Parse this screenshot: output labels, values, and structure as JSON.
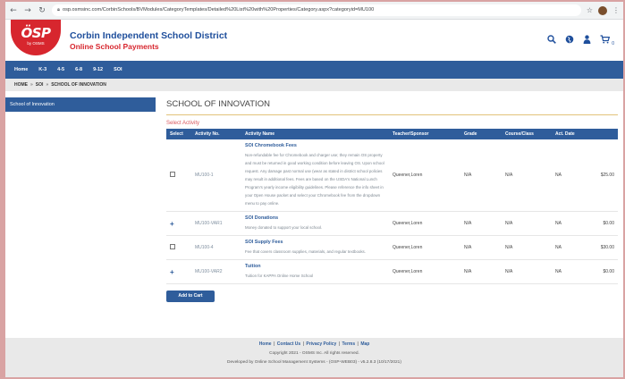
{
  "browser": {
    "url": "osp.osmsinc.com/CorbinSchools/BVModules/CategoryTemplates/Detailed%20List%20with%20Properties/Category.aspx?categoryid=MU100"
  },
  "header": {
    "logo_text": "ÖSP",
    "logo_sub": "by OSMS",
    "district_name": "Corbin Independent School District",
    "tagline": "Online School Payments",
    "cart_count": "0"
  },
  "nav": {
    "items": [
      "Home",
      "K-3",
      "4-5",
      "6-8",
      "9-12",
      "SOI"
    ]
  },
  "breadcrumb": {
    "items": [
      "HOME",
      "SOI",
      "SCHOOL OF INNOVATION"
    ]
  },
  "sidebar": {
    "items": [
      "School of Innovation"
    ]
  },
  "main": {
    "title": "SCHOOL OF INNOVATION",
    "subtitle": "Select Activity",
    "columns": [
      "Select",
      "Activity No.",
      "Activity Name",
      "Teacher/Sponsor",
      "Grade",
      "Course/Class",
      "Act. Date",
      ""
    ],
    "rows": [
      {
        "select": "checkbox",
        "activity_no": "MU100-1",
        "name": "SOI Chromebook Fees",
        "description": "Non-refundable fee for Chromebook and charger use; they remain OS property and must be returned in good working condition before leaving OS. Upon school request. Any damage past normal use (wear as stated in district school policies may result in additional fees. Fees are based on the USDA's National Lunch Program's yearly income eligibility guidelines. Please reference the info sheet in your Open House packet and select your Chromebook fee from the dropdown menu to pay online.",
        "teacher": "Queener,Loren",
        "grade": "N/A",
        "course": "N/A",
        "date": "NA",
        "price": "$25.00"
      },
      {
        "select": "plus",
        "activity_no": "MU100-VAR1",
        "name": "SOI Donations",
        "description": "Money donated to support your local school.",
        "teacher": "Queener,Loren",
        "grade": "N/A",
        "course": "N/A",
        "date": "NA",
        "price": "$0.00"
      },
      {
        "select": "checkbox",
        "activity_no": "MU100-4",
        "name": "SOI Supply Fees",
        "description": "Fee that covers classroom supplies, materials, and regular textbooks.",
        "teacher": "Queener,Loren",
        "grade": "N/A",
        "course": "N/A",
        "date": "NA",
        "price": "$30.00"
      },
      {
        "select": "plus",
        "activity_no": "MU100-VAR2",
        "name": "Tuition",
        "description": "Tuition for KAPPA Online Home School",
        "teacher": "Queener,Loren",
        "grade": "N/A",
        "course": "N/A",
        "date": "NA",
        "price": "$0.00"
      }
    ],
    "add_to_cart": "Add to Cart"
  },
  "footer": {
    "links": [
      "Home",
      "Contact Us",
      "Privacy Policy",
      "Terms",
      "Map"
    ],
    "copyright": "Copyright 2021 - OSMS Inc. All rights reserved.",
    "developed": "Developed by Online School Management Systems - (OSP-WEB03) - v5.2.8.3 (10/17/2021)"
  },
  "colors": {
    "brand_red": "#d7262e",
    "brand_blue": "#2f5d9b",
    "accent_gold": "#e2c37a"
  }
}
